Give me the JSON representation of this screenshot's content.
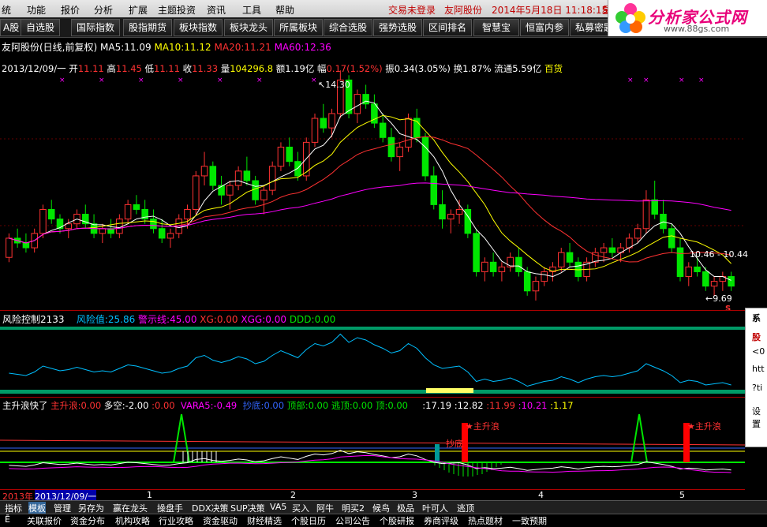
{
  "menu": {
    "items": [
      "统",
      "功能",
      "报价",
      "分析",
      "扩展",
      "主题投资",
      "资讯",
      "工具",
      "帮助"
    ],
    "status1": "交易未登录",
    "status2": "友阿股份",
    "datetime": "2014年5月18日 11:18:15",
    "extra": "星"
  },
  "toolbar": {
    "buttons": [
      "A股",
      "自选股",
      "国际指数",
      "股指期货",
      "板块指数",
      "板块龙头",
      "所属板块",
      "综合选股",
      "强势选股",
      "区间排名",
      "智慧宝",
      "恒富内参",
      "私募密匙"
    ]
  },
  "logo": {
    "title": "分析家公式网",
    "url": "www.88gs.com"
  },
  "main_chart": {
    "name": "友阿股份(日线,前复权)",
    "ma5_label": "MA5:",
    "ma5": "11.09",
    "ma10_label": "MA10:",
    "ma10": "11.12",
    "ma20_label": "MA20:",
    "ma20": "11.21",
    "ma60_label": "MA60:",
    "ma60": "12.36",
    "date": "2013/12/09/一",
    "open_label": "开",
    "open": "11.11",
    "high_label": "高",
    "high": "11.45",
    "low_label": "低",
    "low": "11.11",
    "close_label": "收",
    "close": "11.33",
    "vol_label": "量",
    "vol": "104296.8",
    "amt_label": "额",
    "amt": "1.19亿",
    "chg_label": "幅",
    "chg": "0.17(1.52%)",
    "amp_label": "振",
    "amp": "0.34(3.05%)",
    "turn_label": "换",
    "turn": "1.87%",
    "float_label": "流通",
    "float": "5.59亿",
    "sector": "百货",
    "high_mark": "14.30",
    "low_mark": "9.69",
    "range_mark": "10.46 - 10.44",
    "s_mark": "S"
  },
  "risk_panel": {
    "title": "风险控制2133",
    "risk_label": "风险值:",
    "risk": "25.86",
    "warn_label": "警示线:",
    "warn": "45.00",
    "xg_label": "XG:",
    "xg": "0.00",
    "xgg_label": "XGG:",
    "xgg": "0.00",
    "ddd_label": "DDD:",
    "ddd": "0.00"
  },
  "wave_panel": {
    "title": "主升浪快了",
    "zsl_label": "主升浪:",
    "zsl": "0.00",
    "dk_label": "多空:",
    "dk": "-2.00",
    "dk2": "0.00",
    "vara5_label": "VARA5:",
    "vara5": "-0.49",
    "cd_label": "抄底:",
    "cd": "0.00",
    "db_label": "顶部:",
    "db": "0.00",
    "td_label": "逃顶:",
    "td": "0.00",
    "d_label": "顶:",
    "d": "0.00",
    "v1": "17.19",
    "v2": "12.82",
    "v3": "11.99",
    "v4": "10.21",
    "v5": "1.17",
    "zsl_tag1": "主升浪",
    "zsl_tag2": "主升浪",
    "cd_tag": "抄底"
  },
  "axis": {
    "year": "2013年",
    "date_sel": "2013/12/09/一",
    "months": [
      "1",
      "2",
      "3",
      "4",
      "5"
    ]
  },
  "popup": {
    "lines": [
      "系",
      "股",
      "<0",
      "htt",
      "?ti",
      "设置"
    ]
  },
  "bottom_tabs": [
    "指标",
    "模板",
    "管理",
    "另存为",
    "赢在龙头",
    "操盘手",
    "DDX决策",
    "SUP决策",
    "VA5",
    "买入",
    "阿牛",
    "明买2",
    "候鸟",
    "极品",
    "叶可人",
    "逃顶"
  ],
  "bottom_tabs_selected": 1,
  "bottom_tabs2": [
    "Ē",
    "关联报价",
    "资金分布",
    "机构攻略",
    "行业攻略",
    "资金驱动",
    "财经精选",
    "个股日历",
    "公司公告",
    "个股研报",
    "券商评级",
    "热点题材",
    "一致预期"
  ],
  "colors": {
    "bg": "#000000",
    "up": "#ff3232",
    "down": "#00e600",
    "ma5": "#ffffff",
    "ma10": "#ffff00",
    "ma20": "#ff3232",
    "ma60": "#ff00ff",
    "risk": "#00bfff",
    "accent": "#c00000"
  },
  "chart_data": {
    "type": "line",
    "price_axis_range": [
      9.4,
      14.6
    ],
    "candles": [
      [
        10.4,
        10.9,
        10.3,
        10.8
      ],
      [
        10.8,
        11.0,
        10.6,
        10.7
      ],
      [
        10.7,
        10.9,
        10.5,
        10.6
      ],
      [
        10.6,
        11.0,
        10.5,
        10.9
      ],
      [
        10.9,
        11.5,
        10.8,
        11.4
      ],
      [
        11.4,
        11.6,
        11.1,
        11.2
      ],
      [
        11.2,
        11.3,
        10.9,
        11.0
      ],
      [
        11.0,
        11.2,
        10.8,
        11.1
      ],
      [
        11.1,
        11.4,
        11.0,
        11.3
      ],
      [
        11.3,
        11.5,
        11.0,
        11.1
      ],
      [
        11.1,
        11.3,
        10.8,
        10.9
      ],
      [
        10.9,
        11.1,
        10.7,
        11.0
      ],
      [
        11.0,
        11.2,
        10.8,
        10.9
      ],
      [
        10.9,
        11.3,
        10.8,
        11.2
      ],
      [
        11.2,
        11.6,
        11.1,
        11.5
      ],
      [
        11.5,
        11.7,
        11.3,
        11.4
      ],
      [
        11.4,
        11.6,
        11.1,
        11.2
      ],
      [
        11.2,
        11.4,
        10.9,
        11.0
      ],
      [
        11.0,
        11.2,
        10.7,
        10.8
      ],
      [
        10.8,
        11.0,
        10.6,
        10.9
      ],
      [
        10.9,
        11.3,
        10.8,
        11.2
      ],
      [
        11.2,
        11.5,
        11.0,
        11.4
      ],
      [
        11.4,
        12.2,
        11.3,
        12.1
      ],
      [
        12.1,
        12.6,
        11.9,
        12.3
      ],
      [
        12.3,
        12.4,
        11.8,
        11.9
      ],
      [
        11.9,
        12.1,
        11.5,
        11.7
      ],
      [
        11.7,
        12.0,
        11.4,
        11.9
      ],
      [
        11.9,
        12.3,
        11.8,
        12.2
      ],
      [
        12.2,
        12.5,
        11.9,
        12.0
      ],
      [
        12.0,
        12.1,
        11.5,
        11.6
      ],
      [
        11.6,
        11.9,
        11.3,
        11.8
      ],
      [
        11.8,
        12.4,
        11.7,
        12.3
      ],
      [
        12.3,
        12.8,
        12.2,
        12.7
      ],
      [
        12.7,
        12.9,
        12.3,
        12.4
      ],
      [
        12.4,
        12.6,
        12.0,
        12.1
      ],
      [
        12.1,
        12.9,
        12.0,
        12.8
      ],
      [
        12.8,
        13.4,
        12.7,
        13.3
      ],
      [
        13.3,
        13.6,
        13.0,
        13.1
      ],
      [
        13.1,
        13.5,
        12.9,
        13.4
      ],
      [
        13.4,
        14.3,
        13.3,
        14.1
      ],
      [
        14.1,
        14.2,
        13.3,
        13.4
      ],
      [
        13.4,
        13.9,
        13.2,
        13.8
      ],
      [
        13.8,
        14.0,
        13.5,
        13.6
      ],
      [
        13.6,
        13.8,
        13.1,
        13.2
      ],
      [
        13.2,
        13.4,
        12.8,
        12.9
      ],
      [
        12.9,
        13.1,
        12.4,
        12.5
      ],
      [
        12.5,
        12.8,
        12.2,
        12.7
      ],
      [
        12.7,
        13.4,
        12.6,
        13.3
      ],
      [
        13.3,
        13.5,
        12.8,
        12.9
      ],
      [
        12.9,
        13.0,
        12.0,
        12.1
      ],
      [
        12.1,
        12.3,
        11.4,
        11.5
      ],
      [
        11.5,
        11.8,
        11.0,
        11.2
      ],
      [
        11.2,
        11.4,
        10.9,
        11.3
      ],
      [
        11.3,
        11.6,
        11.1,
        11.4
      ],
      [
        11.4,
        11.5,
        10.8,
        10.9
      ],
      [
        10.9,
        11.0,
        10.0,
        10.1
      ],
      [
        10.1,
        10.4,
        9.9,
        10.3
      ],
      [
        10.3,
        10.5,
        10.0,
        10.1
      ],
      [
        10.1,
        10.3,
        9.9,
        10.2
      ],
      [
        10.2,
        10.5,
        10.1,
        10.4
      ],
      [
        10.4,
        10.6,
        10.0,
        10.1
      ],
      [
        10.1,
        10.2,
        9.6,
        9.7
      ],
      [
        9.7,
        10.0,
        9.5,
        9.9
      ],
      [
        9.9,
        10.2,
        9.8,
        10.1
      ],
      [
        10.1,
        10.3,
        9.9,
        10.2
      ],
      [
        10.2,
        10.6,
        10.1,
        10.5
      ],
      [
        10.5,
        10.7,
        10.2,
        10.3
      ],
      [
        10.3,
        10.4,
        9.9,
        10.0
      ],
      [
        10.0,
        10.4,
        9.9,
        10.3
      ],
      [
        10.3,
        10.6,
        10.2,
        10.5
      ],
      [
        10.5,
        10.7,
        10.3,
        10.6
      ],
      [
        10.6,
        10.8,
        10.4,
        10.5
      ],
      [
        10.5,
        10.7,
        10.3,
        10.6
      ],
      [
        10.6,
        10.9,
        10.5,
        10.8
      ],
      [
        10.8,
        11.1,
        10.7,
        11.0
      ],
      [
        11.0,
        11.8,
        10.9,
        11.6
      ],
      [
        11.6,
        12.0,
        11.2,
        11.3
      ],
      [
        11.3,
        11.6,
        10.9,
        11.0
      ],
      [
        11.0,
        11.1,
        10.5,
        10.6
      ],
      [
        10.6,
        10.8,
        9.9,
        10.0
      ],
      [
        10.0,
        10.3,
        9.8,
        10.2
      ],
      [
        10.2,
        10.4,
        10.0,
        10.1
      ],
      [
        10.1,
        10.2,
        9.7,
        9.8
      ],
      [
        9.8,
        10.0,
        9.6,
        9.9
      ],
      [
        9.9,
        10.1,
        9.7,
        10.0
      ],
      [
        10.0,
        10.1,
        9.7,
        9.8
      ]
    ]
  }
}
